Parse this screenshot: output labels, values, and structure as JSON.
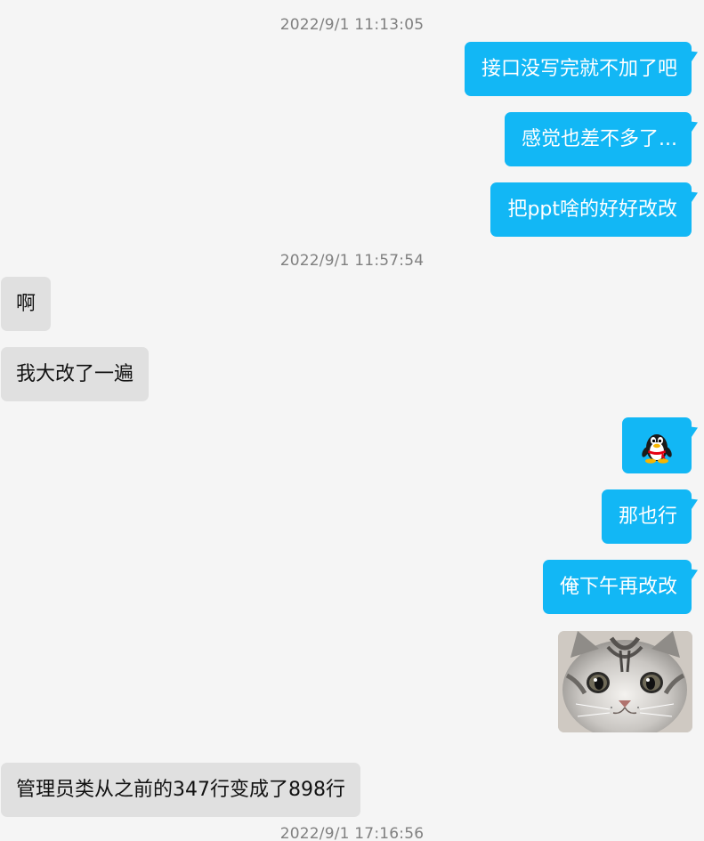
{
  "window": {
    "title": ""
  },
  "messages": {
    "ts1": "2022/9/1 11:13:05",
    "m1": "接口没写完就不加了吧",
    "m2": "感觉也差不多了...",
    "m3": "把ppt啥的好好改改",
    "ts2": "2022/9/1 11:57:54",
    "m4": "啊",
    "m5": "我大改了一遍",
    "m6_icon": "qq-penguin-emoji-icon",
    "m7": "那也行",
    "m8": "俺下午再改改",
    "m9_image": "cat-photo",
    "m10": "管理员类从之前的347行变成了898行",
    "ts3": "2022/9/1 17:16:56"
  },
  "colors": {
    "background": "#f5f5f5",
    "outgoing_bubble": "#12b7f5",
    "incoming_bubble": "#e0e0e0",
    "timestamp": "#808080"
  }
}
